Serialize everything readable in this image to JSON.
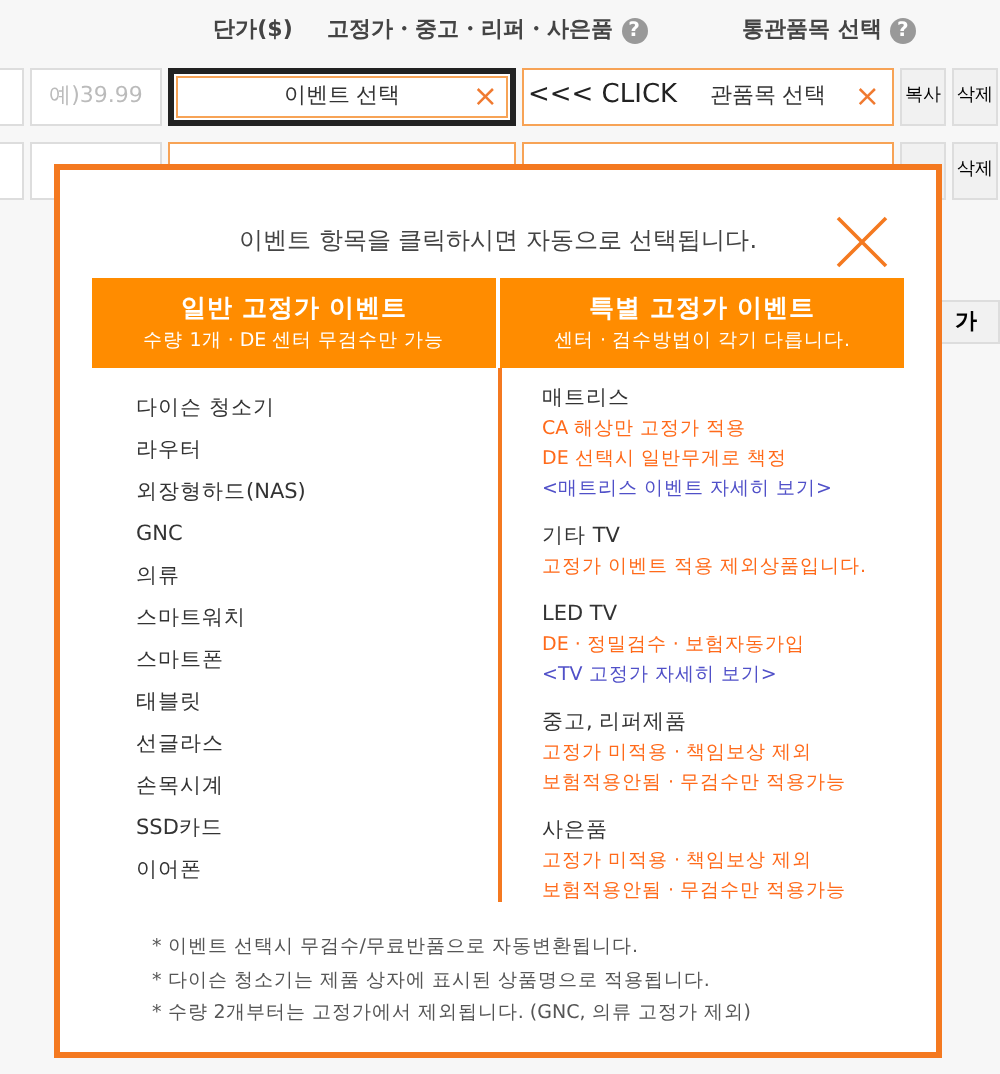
{
  "header": [
    {
      "label": "단가($)"
    },
    {
      "label": "고정가・중고・리퍼・사은품",
      "help": "?"
    },
    {
      "label": "통관품목 선택",
      "help": "?"
    }
  ],
  "rows": [
    {
      "focused": true,
      "price_placeholder": "예)39.99",
      "event_value": "이벤트 선택",
      "event_clear": "×",
      "customs_value": "관품목 선택",
      "customs_clear": "×",
      "copy": "복사",
      "delete": "삭제"
    },
    {
      "focused": false,
      "delete": "삭제"
    }
  ],
  "click_hint": "<<< CLICK",
  "add_button": "가",
  "popup": {
    "title": "이벤트 항목을 클릭하시면 자동으로 선택됩니다.",
    "columns": [
      {
        "title": "일반 고정가 이벤트",
        "subtitle": "수량 1개 · DE 센터 무검수만 가능",
        "items": [
          "다이슨 청소기",
          "라우터",
          "외장형하드(NAS)",
          "GNC",
          "의류",
          "스마트워치",
          "스마트폰",
          "태블릿",
          "선글라스",
          "손목시계",
          "SSD카드",
          "이어폰"
        ]
      },
      {
        "title": "특별 고정가 이벤트",
        "subtitle": "센터 · 검수방법이 각기 다릅니다.",
        "groups": [
          {
            "name": "매트리스",
            "lines": [
              {
                "kind": "note",
                "text": "CA 해상만 고정가 적용"
              },
              {
                "kind": "note",
                "text": "DE 선택시 일반무게로 책정"
              },
              {
                "kind": "link",
                "text": "<매트리스 이벤트 자세히 보기>"
              }
            ]
          },
          {
            "name": "기타 TV",
            "lines": [
              {
                "kind": "note",
                "text": "고정가 이벤트 적용 제외상품입니다."
              }
            ]
          },
          {
            "name": "LED TV",
            "lines": [
              {
                "kind": "note",
                "text": "DE · 정밀검수 · 보험자동가입"
              },
              {
                "kind": "link",
                "text": "<TV 고정가 자세히 보기>"
              }
            ]
          },
          {
            "name": "중고, 리퍼제품",
            "lines": [
              {
                "kind": "note",
                "text": "고정가 미적용 · 책임보상 제외"
              },
              {
                "kind": "note",
                "text": "보험적용안됨 · 무검수만 적용가능"
              }
            ]
          },
          {
            "name": "사은품",
            "lines": [
              {
                "kind": "note",
                "text": "고정가 미적용 · 책임보상 제외"
              },
              {
                "kind": "note",
                "text": "보험적용안됨 · 무검수만 적용가능"
              }
            ]
          }
        ]
      }
    ],
    "notes": [
      "* 이벤트 선택시 무검수/무료반품으로 자동변환됩니다.",
      "* 다이슨 청소기는 제품 상자에 표시된 상품명으로 적용됩니다.",
      "* 수량 2개부터는 고정가에서 제외됩니다. (GNC, 의류 고정가 제외)"
    ]
  }
}
